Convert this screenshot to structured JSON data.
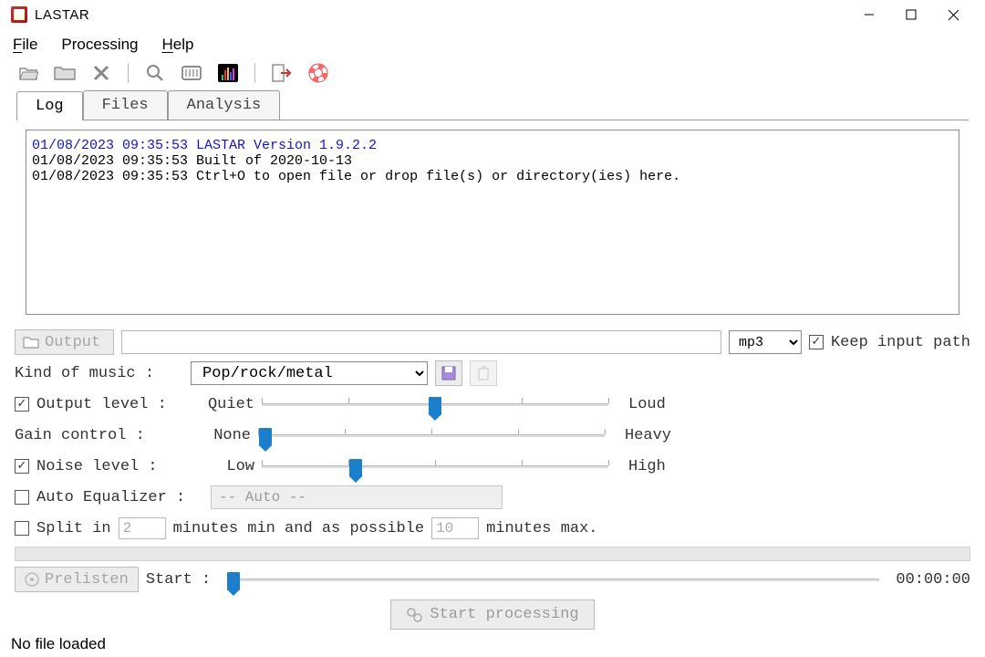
{
  "window": {
    "title": "LASTAR"
  },
  "menu": {
    "file": "File",
    "processing": "Processing",
    "help": "Help"
  },
  "tabs": [
    "Log",
    "Files",
    "Analysis"
  ],
  "active_tab": 0,
  "log": {
    "line1": "01/08/2023 09:35:53 LASTAR Version 1.9.2.2",
    "line2": "01/08/2023 09:35:53 Built of 2020-10-13",
    "line3": "01/08/2023 09:35:53 Ctrl+O to open file or drop file(s) or directory(ies) here."
  },
  "output": {
    "button": "Output",
    "path": "",
    "format": "mp3",
    "keep_input_path_label": "Keep input path",
    "keep_input_path": true
  },
  "kind_label": "Kind of music :",
  "kind_value": "Pop/rock/metal",
  "sliders": {
    "output_level": {
      "label": "Output level :",
      "left": "Quiet",
      "right": "Loud",
      "pos": 50,
      "checked": true
    },
    "gain_control": {
      "label": "Gain control :",
      "left": "None",
      "right": "Heavy",
      "pos": 2
    },
    "noise_level": {
      "label": "Noise level :",
      "left": "Low",
      "right": "High",
      "pos": 27,
      "checked": true
    }
  },
  "auto_eq": {
    "label": "Auto Equalizer :",
    "value": "-- Auto --",
    "checked": false
  },
  "split": {
    "label": "Split in",
    "min": "2",
    "mid": "minutes min and as possible",
    "max": "10",
    "tail": "minutes max.",
    "checked": false
  },
  "prelisten": {
    "button": "Prelisten",
    "start": "Start :",
    "time": "00:00:00"
  },
  "start_processing": "Start processing",
  "status": "No file loaded"
}
